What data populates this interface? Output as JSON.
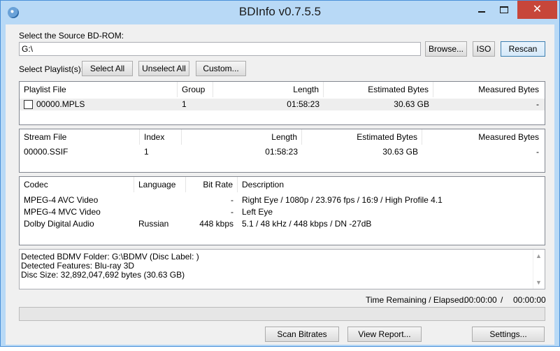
{
  "window": {
    "title": "BDInfo v0.7.5.5"
  },
  "source": {
    "label": "Select the Source BD-ROM:",
    "path": "G:\\",
    "browse_label": "Browse...",
    "iso_label": "ISO",
    "rescan_label": "Rescan"
  },
  "playlists_bar": {
    "label": "Select Playlist(s):",
    "select_all_label": "Select All",
    "unselect_all_label": "Unselect All",
    "custom_label": "Custom..."
  },
  "playlist_table": {
    "headers": [
      "Playlist File",
      "Group",
      "Length",
      "Estimated Bytes",
      "Measured Bytes"
    ],
    "rows": [
      {
        "file": "00000.MPLS",
        "group": "1",
        "length": "01:58:23",
        "estimated": "30.63 GB",
        "measured": "-",
        "checked": false
      }
    ]
  },
  "stream_table": {
    "headers": [
      "Stream File",
      "Index",
      "Length",
      "Estimated Bytes",
      "Measured Bytes"
    ],
    "rows": [
      {
        "file": "00000.SSIF",
        "index": "1",
        "length": "01:58:23",
        "estimated": "30.63 GB",
        "measured": "-"
      }
    ]
  },
  "codec_table": {
    "headers": [
      "Codec",
      "Language",
      "Bit Rate",
      "Description"
    ],
    "rows": [
      {
        "codec": "MPEG-4 AVC Video",
        "language": "",
        "bitrate": "-",
        "description": "Right Eye / 1080p / 23.976 fps / 16:9 / High Profile 4.1"
      },
      {
        "codec": "MPEG-4 MVC Video",
        "language": "",
        "bitrate": "-",
        "description": "Left Eye"
      },
      {
        "codec": "Dolby Digital Audio",
        "language": "Russian",
        "bitrate": "448 kbps",
        "description": "5.1 / 48 kHz /  448 kbps / DN -27dB"
      }
    ]
  },
  "log": {
    "lines": [
      "Detected BDMV Folder: G:\\BDMV (Disc Label: )",
      "Detected Features: Blu-ray 3D",
      "Disc Size: 32,892,047,692 bytes (30.63 GB)"
    ]
  },
  "status": {
    "time_label": "Time Remaining / Elapsed:",
    "remaining": "00:00:00",
    "separator": "/",
    "elapsed": "00:00:00",
    "progress_percent": 0
  },
  "footer": {
    "scan_label": "Scan Bitrates",
    "report_label": "View Report...",
    "settings_label": "Settings..."
  },
  "icons": {
    "app": "bdinfo-disc-icon",
    "minimize": "minimize-icon",
    "maximize": "maximize-icon",
    "close": "close-icon"
  },
  "colors": {
    "window_frame": "#b8d9f6",
    "close_button": "#c7463a",
    "focused_button_border": "#3c7fb1",
    "progress_fill": "#06b025"
  }
}
